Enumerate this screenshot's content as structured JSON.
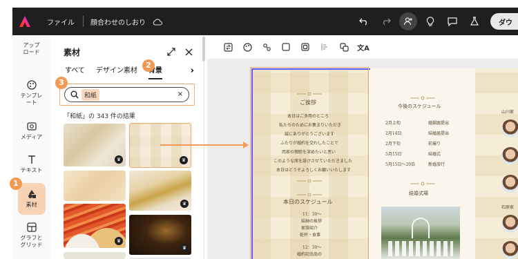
{
  "topbar": {
    "menu_label": "ファイル",
    "document_title": "顔合わせのしおり",
    "download_label": "ダウ"
  },
  "rail": {
    "items": [
      {
        "label_line1": "アップ",
        "label_line2": "ロード",
        "icon": "upload-icon"
      },
      {
        "label_line1": "テンプレ",
        "label_line2": "ート",
        "icon": "template-icon"
      },
      {
        "label_line1": "メディア",
        "label_line2": "",
        "icon": "media-icon"
      },
      {
        "label_line1": "テキスト",
        "label_line2": "",
        "icon": "text-icon"
      },
      {
        "label_line1": "素材",
        "label_line2": "",
        "icon": "elements-icon"
      },
      {
        "label_line1": "グラフと",
        "label_line2": "グリッド",
        "icon": "grid-icon"
      }
    ]
  },
  "panel": {
    "title": "素材",
    "tabs": [
      "すべて",
      "デザイン素材",
      "背景"
    ],
    "search_value": "和紙",
    "result_count": "「和紙」の 343 件の結果"
  },
  "markers": [
    "1",
    "2",
    "3"
  ],
  "document": {
    "greeting_title": "ご挨拶",
    "greeting_lines": [
      "本日はご多用のところ",
      "私たちのためにお集まりいただき",
      "誠にありがとうございます",
      "ふたりが婚約を交わしたことで",
      "両家の親睦を深めたいと思い",
      "このような席を設けさせていただきました",
      "本日はどうぞよろしくお願いいたします"
    ],
    "schedule_title": "本日のスケジュール",
    "schedule_lines": [
      "11：30～",
      "結納の挨拶",
      "家族紹介",
      "乾杯・食事",
      "",
      "12：30～",
      "婚約記念品の"
    ],
    "future_title": "今後のスケジュール",
    "future_rows": [
      {
        "date": "2月上旬",
        "event": "婚姻届提出"
      },
      {
        "date": "2月14日",
        "event": "結婚届提出"
      },
      {
        "date": "2月下旬",
        "event": "前撮り"
      },
      {
        "date": "5月15日",
        "event": "結婚式"
      },
      {
        "date": "5月15日～20日",
        "event": "新婚旅行"
      }
    ],
    "venue_title": "結婚式場",
    "right_names": [
      "山川家",
      "石原家"
    ]
  }
}
